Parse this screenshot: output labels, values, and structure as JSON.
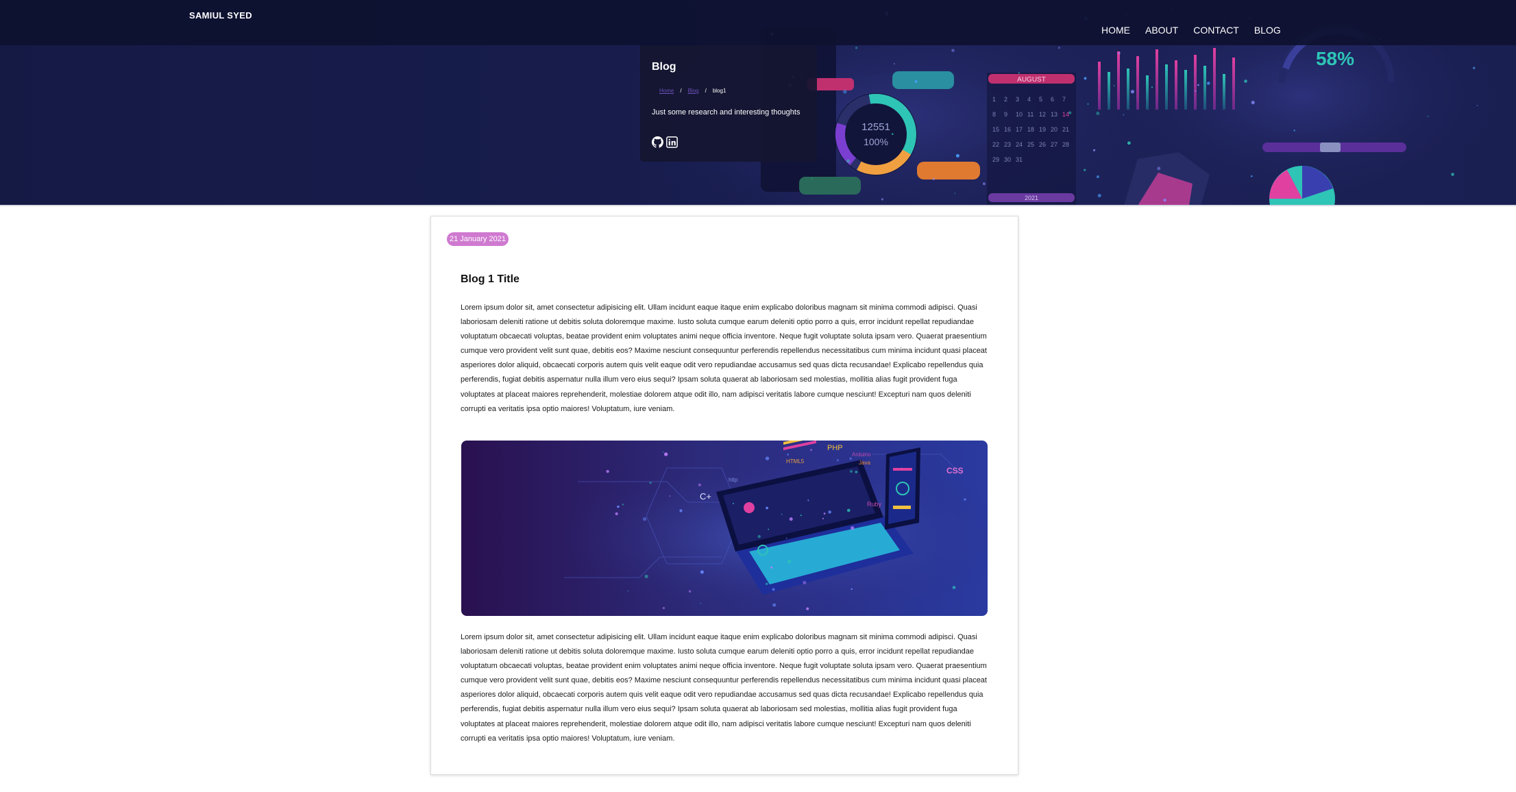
{
  "brand": "SAMIUL SYED",
  "nav": [
    "HOME",
    "ABOUT",
    "CONTACT",
    "BLOG"
  ],
  "hero": {
    "title": "Blog",
    "breadcrumb": [
      "Home",
      "Blog",
      "blog1"
    ],
    "breadcrumb_separator": "/",
    "subtitle": "Just some research and interesting thoughts",
    "dashboard_labels": {
      "month": "AUGUST",
      "year": "2021",
      "donut_value": "12551",
      "donut_pct": "100%",
      "gauge_pct": "58%",
      "calendar": [
        "1",
        "2",
        "3",
        "4",
        "5",
        "6",
        "7",
        "8",
        "9",
        "10",
        "11",
        "12",
        "13",
        "14",
        "15",
        "16",
        "17",
        "18",
        "19",
        "20",
        "21",
        "22",
        "23",
        "24",
        "25",
        "26",
        "27",
        "28",
        "29",
        "30",
        "31"
      ]
    },
    "socials": [
      {
        "name": "github-icon"
      },
      {
        "name": "linkedin-icon"
      }
    ]
  },
  "post": {
    "date": "21 January 2021",
    "title": "Blog 1 Title",
    "paragraph1": "Lorem ipsum dolor sit, amet consectetur adipisicing elit. Ullam incidunt eaque itaque enim explicabo doloribus magnam sit minima commodi adipisci. Quasi laboriosam deleniti ratione ut debitis soluta doloremque maxime. Iusto soluta cumque earum deleniti optio porro a quis, error incidunt repellat repudiandae voluptatum obcaecati voluptas, beatae provident enim voluptates animi neque officia inventore. Neque fugit voluptate soluta ipsam vero. Quaerat praesentium cumque vero provident velit sunt quae, debitis eos? Maxime nesciunt consequuntur perferendis repellendus necessitatibus cum minima incidunt quasi placeat asperiores dolor aliquid, obcaecati corporis autem quis velit eaque odit vero repudiandae accusamus sed quas dicta recusandae! Explicabo repellendus quia perferendis, fugiat debitis aspernatur nulla illum vero eius sequi? Ipsam soluta quaerat ab laboriosam sed molestias, mollitia alias fugit provident fuga voluptates at placeat maiores reprehenderit, molestiae dolorem atque odit illo, nam adipisci veritatis labore cumque nesciunt! Excepturi nam quos deleniti corrupti ea veritatis ipsa optio maiores! Voluptatum, iure veniam.",
    "image_labels": [
      "PHP",
      "HTML5",
      "Arduino",
      "Java",
      "CSS",
      "C+",
      "Ruby",
      "http"
    ],
    "paragraph2": "Lorem ipsum dolor sit, amet consectetur adipisicing elit. Ullam incidunt eaque itaque enim explicabo doloribus magnam sit minima commodi adipisci. Quasi laboriosam deleniti ratione ut debitis soluta doloremque maxime. Iusto soluta cumque earum deleniti optio porro a quis, error incidunt repellat repudiandae voluptatum obcaecati voluptas, beatae provident enim voluptates animi neque officia inventore. Neque fugit voluptate soluta ipsam vero. Quaerat praesentium cumque vero provident velit sunt quae, debitis eos? Maxime nesciunt consequuntur perferendis repellendus necessitatibus cum minima incidunt quasi placeat asperiores dolor aliquid, obcaecati corporis autem quis velit eaque odit vero repudiandae accusamus sed quas dicta recusandae! Explicabo repellendus quia perferendis, fugiat debitis aspernatur nulla illum vero eius sequi? Ipsam soluta quaerat ab laboriosam sed molestias, mollitia alias fugit provident fuga voluptates at placeat maiores reprehenderit, molestiae dolorem atque odit illo, nam adipisci veritatis labore cumque nesciunt! Excepturi nam quos deleniti corrupti ea veritatis ipsa optio maiores! Voluptatum, iure veniam."
  },
  "colors": {
    "hero_bg": "#171c4c",
    "navbar_bg": "#0e1130",
    "badge": "#cf7ad0",
    "accent_teal": "#2ec4b6",
    "accent_pink": "#e040a0",
    "accent_orange": "#f0a040"
  }
}
